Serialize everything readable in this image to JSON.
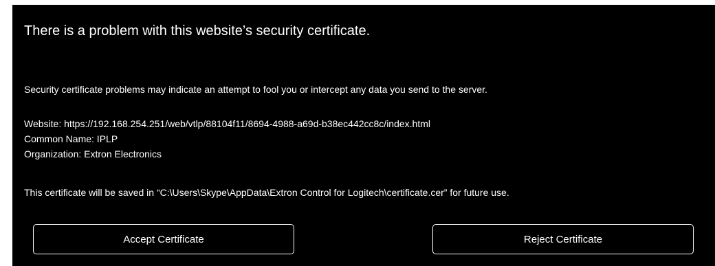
{
  "dialog": {
    "title": "There is a problem with this website’s security certificate.",
    "warning": "Security certificate problems may indicate an attempt to fool you or intercept any data you send to the server.",
    "website": "Website: https://192.168.254.251/web/vtlp/88104f11/8694-4988-a69d-b38ec442cc8c/index.html",
    "common_name": "Common Name: IPLP",
    "organization": "Organization: Extron Electronics",
    "saved_note": "This certificate will be saved in “C:\\Users\\Skype\\AppData\\Extron Control for Logitech\\certificate.cer” for future use.",
    "buttons": {
      "accept": "Accept Certificate",
      "reject": "Reject Certificate"
    }
  },
  "colors": {
    "dialog_background": "#000000",
    "text": "#ffffff",
    "page_background": "#ffffff"
  }
}
